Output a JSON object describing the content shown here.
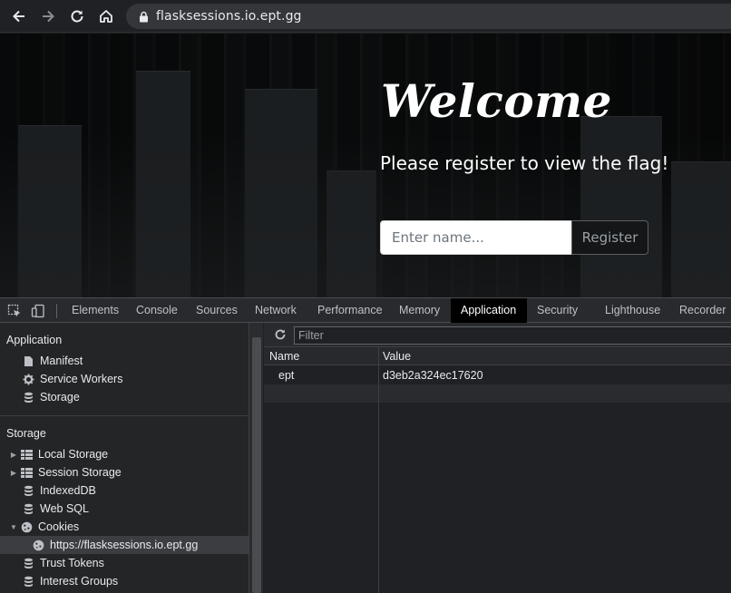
{
  "browser": {
    "url": "flasksessions.io.ept.gg",
    "icons": [
      "back-arrow-icon",
      "forward-arrow-icon",
      "reload-icon",
      "home-icon",
      "lock-icon"
    ]
  },
  "page": {
    "heading": "Welcome",
    "subtitle": "Please register to view the flag!",
    "name_placeholder": "Enter name...",
    "register_label": "Register"
  },
  "devtools": {
    "tabs": [
      {
        "label": "Elements"
      },
      {
        "label": "Console"
      },
      {
        "label": "Sources"
      },
      {
        "label": "Network"
      },
      {
        "label": "Performance"
      },
      {
        "label": "Memory"
      },
      {
        "label": "Application",
        "active": true
      },
      {
        "label": "Security"
      },
      {
        "label": "Lighthouse"
      },
      {
        "label": "Recorder"
      }
    ],
    "sidebar": {
      "application_title": "Application",
      "application_items": [
        {
          "label": "Manifest",
          "icon": "file-icon"
        },
        {
          "label": "Service Workers",
          "icon": "gear-icon"
        },
        {
          "label": "Storage",
          "icon": "database-icon"
        }
      ],
      "storage_title": "Storage",
      "storage_items": [
        {
          "label": "Local Storage",
          "icon": "table-grid-icon",
          "expandable": "collapsed"
        },
        {
          "label": "Session Storage",
          "icon": "table-grid-icon",
          "expandable": "collapsed"
        },
        {
          "label": "IndexedDB",
          "icon": "database-icon"
        },
        {
          "label": "Web SQL",
          "icon": "database-icon"
        },
        {
          "label": "Cookies",
          "icon": "cookie-icon",
          "expandable": "expanded"
        },
        {
          "label": "https://flasksessions.io.ept.gg",
          "icon": "cookie-icon",
          "selected": true,
          "child": true
        },
        {
          "label": "Trust Tokens",
          "icon": "database-icon"
        },
        {
          "label": "Interest Groups",
          "icon": "database-icon"
        }
      ]
    },
    "filter_placeholder": "Filter",
    "cookie_table": {
      "columns": [
        "Name",
        "Value"
      ],
      "rows": [
        {
          "name": "ept",
          "value": "d3eb2a324ec17620"
        }
      ]
    }
  }
}
